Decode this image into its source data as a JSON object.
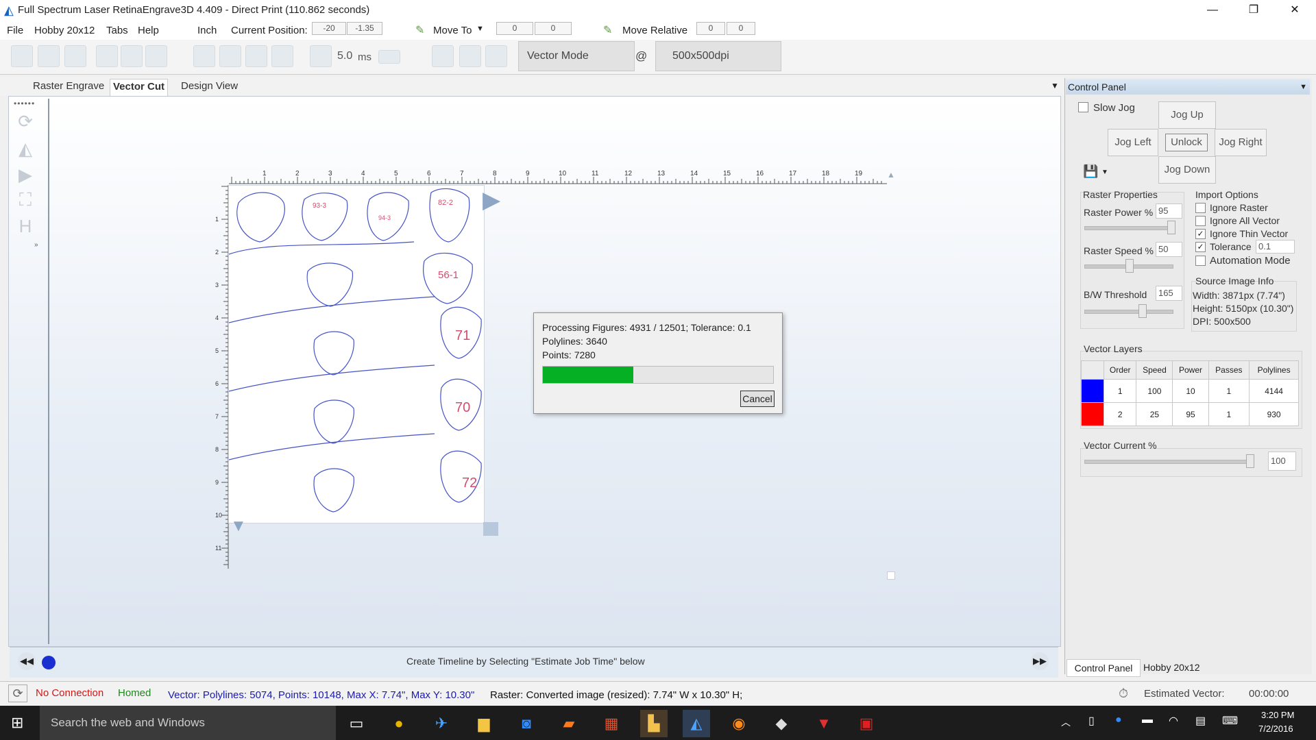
{
  "window": {
    "title": "Full Spectrum Laser RetinaEngrave3D 4.409 - Direct Print (110.862 seconds)",
    "minimize": "—",
    "maximize": "❐",
    "close": "✕"
  },
  "menu": {
    "file": "File",
    "hobby": "Hobby 20x12",
    "tabs": "Tabs",
    "help": "Help",
    "unit": "Inch",
    "current_position_label": "Current Position:",
    "current_x": "-20",
    "current_y": "-1.35",
    "move_to_label": "Move To",
    "move_to_x": "0",
    "move_to_y": "0",
    "move_relative_label": "Move Relative",
    "move_rel_x": "0",
    "move_rel_y": "0"
  },
  "toolbar": {
    "pulse_value": "5.0",
    "pulse_unit": "ms",
    "mode": "Vector Mode",
    "at": "@",
    "dpi": "500x500dpi"
  },
  "tabs": [
    "Raster Engrave",
    "Vector Cut",
    "Design View"
  ],
  "active_tab": "Vector Cut",
  "ruler": {
    "top": [
      "1",
      "2",
      "3",
      "4",
      "5",
      "6",
      "7",
      "8",
      "9",
      "10",
      "11",
      "12",
      "13",
      "14",
      "15",
      "16",
      "17",
      "18",
      "19"
    ],
    "left": [
      "1",
      "2",
      "3",
      "4",
      "5",
      "6",
      "7",
      "8",
      "9",
      "10",
      "11"
    ]
  },
  "artwork_labels": [
    "93-3",
    "94-3",
    "82-2",
    "56-1",
    "71",
    "70",
    "72"
  ],
  "dialog": {
    "line1": "Processing Figures: 4931 / 12501; Tolerance: 0.1",
    "line2": "Polylines: 3640",
    "line3": "Points: 7280",
    "progress": 0.394,
    "cancel": "Cancel"
  },
  "timeline": {
    "hint": "Create Timeline by Selecting \"Estimate Job Time\" below"
  },
  "control_panel": {
    "title": "Control Panel",
    "slow_jog": "Slow Jog",
    "jog_up": "Jog Up",
    "jog_left": "Jog Left",
    "unlock": "Unlock",
    "jog_right": "Jog Right",
    "jog_down": "Jog Down",
    "raster_properties": "Raster Properties",
    "raster_power_label": "Raster Power %",
    "raster_power": "95",
    "raster_speed_label": "Raster Speed %",
    "raster_speed": "50",
    "bw_threshold_label": "B/W Threshold",
    "bw_threshold": "165",
    "import_options": "Import Options",
    "ignore_raster": "Ignore Raster",
    "ignore_all_vector": "Ignore All Vector",
    "ignore_thin_vector": "Ignore Thin Vector",
    "tolerance_label": "Tolerance",
    "tolerance": "0.1",
    "automation_mode": "Automation Mode",
    "source_image_info": "Source Image Info",
    "width": "Width:  3871px (7.74\")",
    "height": "Height: 5150px (10.30\")",
    "dpi": "DPI: 500x500",
    "vector_layers": "Vector Layers",
    "layer_headers": [
      "Order",
      "Speed",
      "Power",
      "Passes",
      "Polylines"
    ],
    "layers": [
      {
        "color": "#0000ff",
        "order": "1",
        "speed": "100",
        "power": "10",
        "passes": "1",
        "polylines": "4144"
      },
      {
        "color": "#ff0000",
        "order": "2",
        "speed": "25",
        "power": "95",
        "passes": "1",
        "polylines": "930"
      }
    ],
    "vector_current_label": "Vector Current %",
    "vector_current": "100",
    "bottom_tabs": [
      "Control Panel",
      "Hobby 20x12"
    ]
  },
  "status": {
    "no_connection": "No Connection",
    "homed": "Homed",
    "vector_info": "Vector: Polylines: 5074, Points: 10148, Max X: 7.74\", Max Y: 10.30\"",
    "raster_info": "Raster: Converted image (resized): 7.74\" W x 10.30\" H;",
    "estimated_label": "Estimated Vector:",
    "estimated_time": "00:00:00"
  },
  "taskbar": {
    "search": "Search the web and Windows",
    "time": "3:20 PM",
    "date": "7/2/2016"
  }
}
